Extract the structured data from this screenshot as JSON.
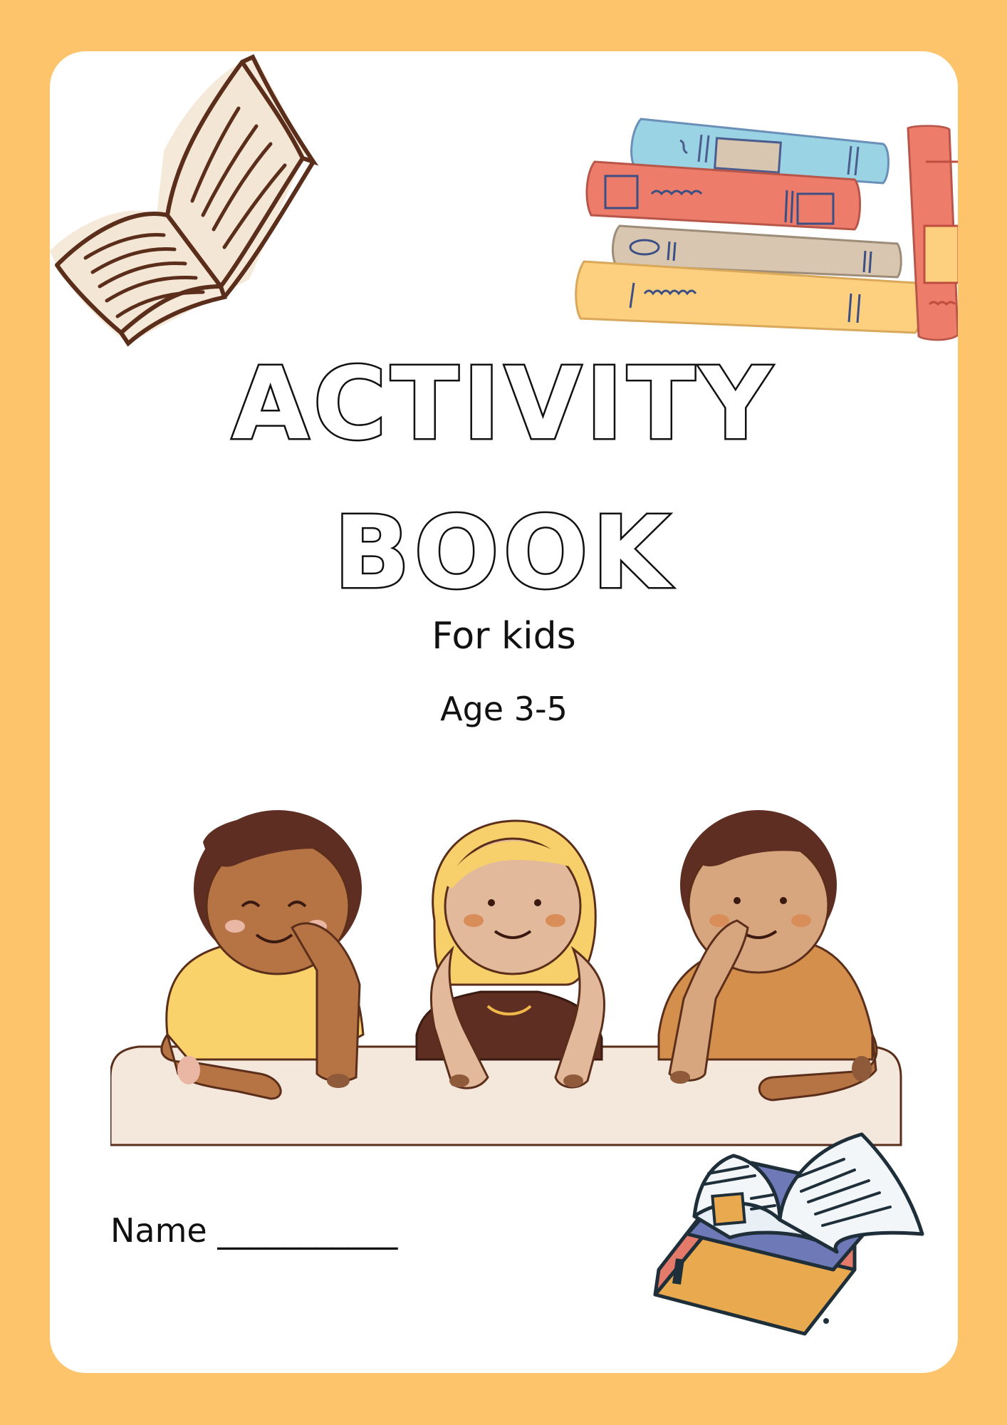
{
  "cover": {
    "title_line1": "ACTIVITY",
    "title_line2": "BOOK",
    "subtitle": "For kids",
    "age": "Age 3-5",
    "name_label": "Name ___________"
  },
  "colors": {
    "border": "#FEC46C",
    "card": "#FFFFFF",
    "text": "#111111",
    "book_blue": "#9AD3E3",
    "book_red": "#EE7C6A",
    "book_tan": "#D8C6B0",
    "book_yellow": "#FCD07E",
    "outline_brown": "#5A2E1A"
  },
  "icons": [
    "open-book-sketch",
    "book-stack",
    "children-at-table",
    "open-book-on-books"
  ]
}
